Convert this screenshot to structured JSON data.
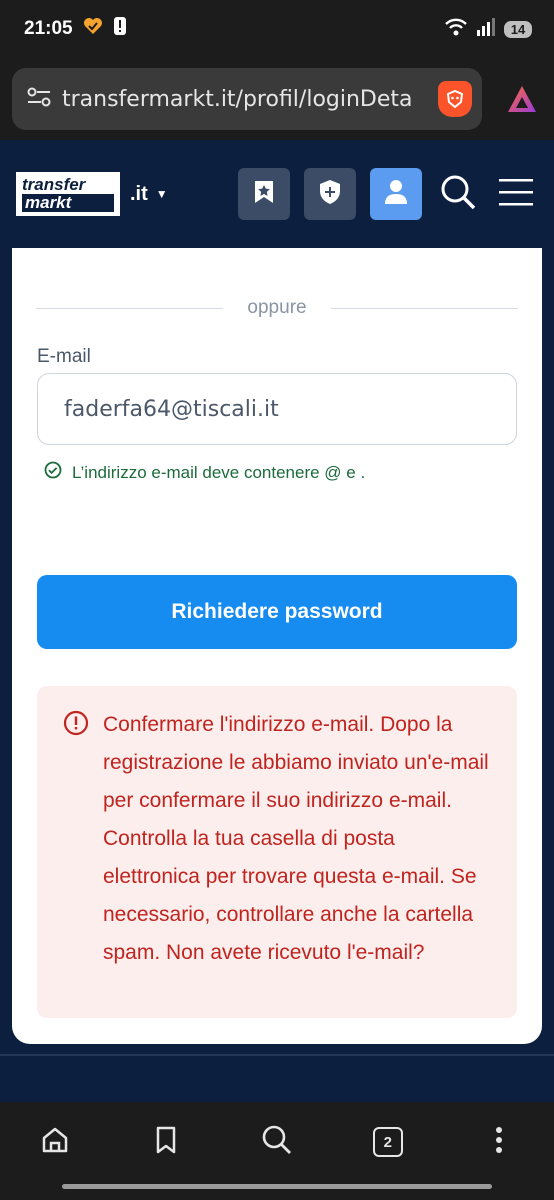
{
  "status_bar": {
    "time": "21:05",
    "battery": "14"
  },
  "browser": {
    "url": "transfermarkt.it/profil/loginDeta"
  },
  "site": {
    "logo_line1": "transfer",
    "logo_line2": "markt",
    "logo_tld": ".it",
    "accent": "#0d1f3f"
  },
  "form": {
    "divider_text": "oppure",
    "email_label": "E-mail",
    "email_value": "faderfa64@tiscali.it",
    "hint": "L’indirizzo e-mail deve contenere @ e .",
    "submit_label": "Richiedere password",
    "button_color": "#168bf0"
  },
  "alert": {
    "message": "Confermare l'indirizzo e-mail. Dopo la registrazione le abbiamo inviato un'e-mail per confermare il suo indirizzo e-mail. Controlla la tua casella di posta elettronica per trovare questa e-mail. Se necessario, controllare anche la cartella spam. Non avete ricevuto l'e-mail?",
    "color": "#c0241e"
  },
  "bottom_nav": {
    "tab_count": "2"
  }
}
